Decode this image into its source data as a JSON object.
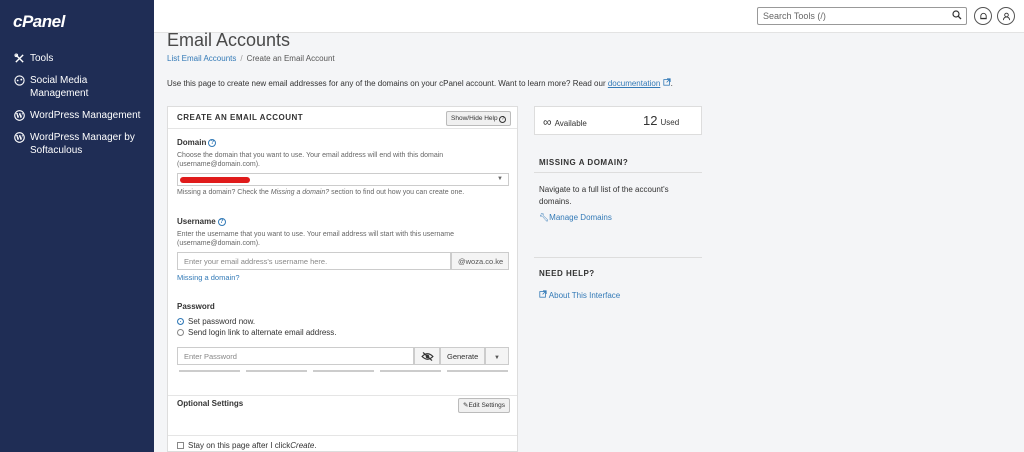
{
  "sidebar": {
    "logo": "cPanel",
    "items": [
      {
        "label": "Tools",
        "icon": "tools-icon"
      },
      {
        "label": "Social Media Management",
        "icon": "social-icon"
      },
      {
        "label": "WordPress Management",
        "icon": "wordpress-icon"
      },
      {
        "label": "WordPress Manager by Softaculous",
        "icon": "wordpress-icon"
      }
    ]
  },
  "topbar": {
    "search_placeholder": "Search Tools (/)"
  },
  "page": {
    "title": "Email Accounts",
    "breadcrumb_link": "List Email Accounts",
    "breadcrumb_sep": "/",
    "breadcrumb_current": "Create an Email Account",
    "intro_text": "Use this page to create new email addresses for any of the domains on your cPanel account. Want to learn more? Read our",
    "intro_link": "documentation",
    "intro_end": "."
  },
  "form": {
    "heading": "CREATE AN EMAIL ACCOUNT",
    "show_hide_help": "Show/Hide Help",
    "domain_label": "Domain",
    "domain_help": "Choose the domain that you want to use. Your email address will end with this domain (username@domain.com).",
    "domain_missing_note_1": "Missing a domain? Check the ",
    "domain_missing_note_em": "Missing a domain?",
    "domain_missing_note_2": " section to find out how you can create one.",
    "username_label": "Username",
    "username_help": "Enter the username that you want to use. Your email address will start with this username (username@domain.com).",
    "username_placeholder": "Enter your email address's username here.",
    "username_suffix": "@woza.co.ke",
    "missing_domain_link": "Missing a domain?",
    "password_label": "Password",
    "radio_set_password": "Set password now.",
    "radio_send_link": "Send login link to alternate email address.",
    "password_placeholder": "Enter Password",
    "generate_label": "Generate",
    "optional_settings": "Optional Settings",
    "edit_settings": "Edit Settings",
    "stay_on_page_1": "Stay on this page after I click ",
    "stay_on_page_em": "Create",
    "stay_on_page_2": "."
  },
  "stats": {
    "available_value": "∞",
    "available_label": "Available",
    "used_value": "12",
    "used_label": "Used"
  },
  "side": {
    "missing_heading": "MISSING A DOMAIN?",
    "missing_text": "Navigate to a full list of the account's domains.",
    "manage_domains": "Manage Domains",
    "help_heading": "NEED HELP?",
    "about_link": "About This Interface"
  },
  "colors": {
    "sidebar_bg": "#1f2d55",
    "link": "#337ab7",
    "redaction": "#e01b1b"
  }
}
